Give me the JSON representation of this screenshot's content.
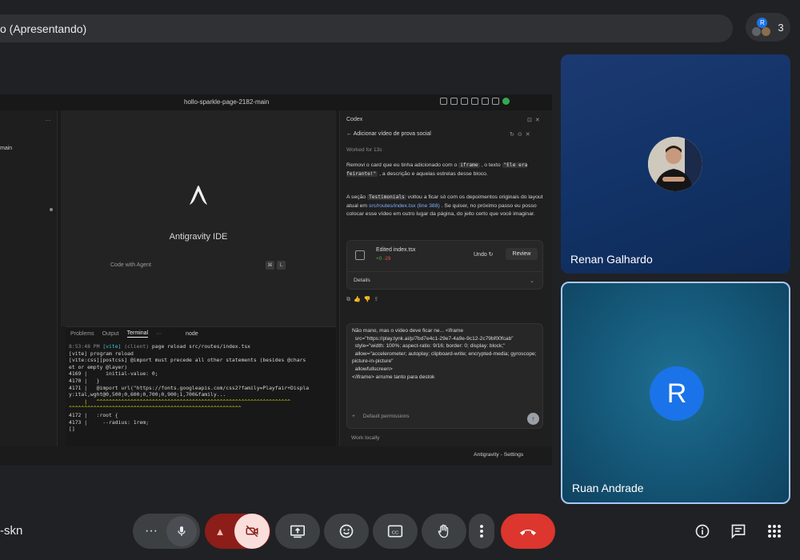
{
  "presenting_bar": {
    "text": "o (Apresentando)"
  },
  "people": {
    "count": "3",
    "avatar_letter": "R"
  },
  "shared_screen": {
    "window_title": "hollo-sparkle-page-2182-main",
    "left_panel": {
      "dots": "···",
      "item": "main"
    },
    "editor": {
      "app_name": "Antigravity IDE",
      "hint": "Code with Agent",
      "key1": "⌘",
      "key2": "L"
    },
    "terminal": {
      "tabs": [
        "Problems",
        "Output",
        "Terminal",
        "···"
      ],
      "node_label": "node",
      "lines": [
        {
          "prefix": "8:53:48 PM ",
          "tag": "[vite]",
          "mid": " (client) ",
          "text": "page reload src/routes/index.tsx"
        },
        {
          "prefix": "",
          "tag": "",
          "mid": "",
          "text": "[vite] program reload"
        },
        {
          "prefix": "",
          "tag": "",
          "mid": "",
          "text": "[vite:css][postcss] @import must precede all other statements (besides @chars"
        },
        {
          "prefix": "",
          "tag": "",
          "mid": "",
          "text": "et or empty @layer)"
        },
        {
          "prefix": "",
          "tag": "",
          "mid": "",
          "text": "4169 |      initial-value: 0;"
        },
        {
          "prefix": "",
          "tag": "",
          "mid": "",
          "text": "4170 |   }"
        },
        {
          "prefix": "",
          "tag": "",
          "mid": "",
          "text": "4171 |   @import url(\"https://fonts.googleapis.com/css2?family=Playfair+Displa"
        },
        {
          "prefix": "",
          "tag": "",
          "mid": "",
          "text": "y:ital,wght@0,500;0,600;0,700;0,900;1,700&family..."
        },
        {
          "prefix": "",
          "tag": "",
          "mid": "",
          "text": "     |   ^^^^^^^^^^^^^^^^^^^^^^^^^^^^^^^^^^^^^^^^^^^^^^^^^^^^^^^^^^^^^^^"
        },
        {
          "prefix": "",
          "tag": "",
          "mid": "",
          "text": "^^^^^^^^^^^^^^^^^^^^^^^^^^^^^^^^^^^^^^^^^^^^^^^^^^^^^^^^"
        },
        {
          "prefix": "",
          "tag": "",
          "mid": "",
          "text": "4172 |   :root {"
        },
        {
          "prefix": "",
          "tag": "",
          "mid": "",
          "text": "4173 |     --radius: 1rem;"
        },
        {
          "prefix": "",
          "tag": "",
          "mid": "",
          "text": "[]"
        }
      ]
    },
    "codex": {
      "header": "Codex",
      "thread_title": "Adicionar vídeo de prova social",
      "worked": "Worked for 13s",
      "p1_a": "Removi o card que eu tinha adicionado com o ",
      "p1_code1": "iframe",
      "p1_b": " , o texto ",
      "p1_code2": "\"Ele era feirante!\"",
      "p1_c": " , a descrição e aquelas estrelas desse bloco.",
      "p2_a": "A seção ",
      "p2_code": "Testimonials",
      "p2_b": " voltou a ficar só com os depoimentos originais do layout atual em ",
      "p2_link": "src/routes/index.tsx (line 388)",
      "p2_c": " . Se quiser, no próximo passo eu posso colocar esse vídeo em outro lugar da página, do jeito certo que você imaginar.",
      "edit_file": "Edited index.tsx",
      "diff_add": "+0",
      "diff_del": "-29",
      "undo_label": "Undo ↻",
      "review_label": "Review",
      "details_label": "Details",
      "composer_text": "Não mano, mas o vídeo deve ficar ne... <iframe\n  src=\"https://play.tynk.ai/p/7bd7e4c1-29e7-4a9e-9c12-2c79bf00fcab\"\n  style=\"width: 100%; aspect-ratio: 9/16; border: 0; display: block;\"\n  allow=\"accelerometer; autoplay; clipboard-write; encrypted-media; gyroscope; picture-in-picture\"\n  allowfullscreen>\n</iframe> arrume tanto para destok",
      "permissions": "Default permissions",
      "work_locally": "Work locally"
    },
    "status_settings": "Antigravity - Settings"
  },
  "participants": [
    {
      "name": "Renan Galhardo",
      "avatar": "photo"
    },
    {
      "name": "Ruan Andrade",
      "avatar_letter": "R"
    }
  ],
  "meeting_code": "-skn",
  "colors": {
    "end_call": "#dc362e",
    "cam_off": "#8c1d18",
    "avatar_blue": "#1a73e8",
    "active_border": "#a8c7fa"
  },
  "icons": {
    "more": "more-options-icon",
    "mic": "microphone-icon",
    "chevron": "chevron-up-icon",
    "camera": "camera-off-icon",
    "present": "present-screen-icon",
    "emoji": "emoji-icon",
    "captions": "captions-icon",
    "hand": "raise-hand-icon",
    "dots": "more-vert-icon",
    "end": "end-call-icon",
    "info": "info-icon",
    "chat": "chat-icon",
    "activities": "apps-grid-icon"
  }
}
